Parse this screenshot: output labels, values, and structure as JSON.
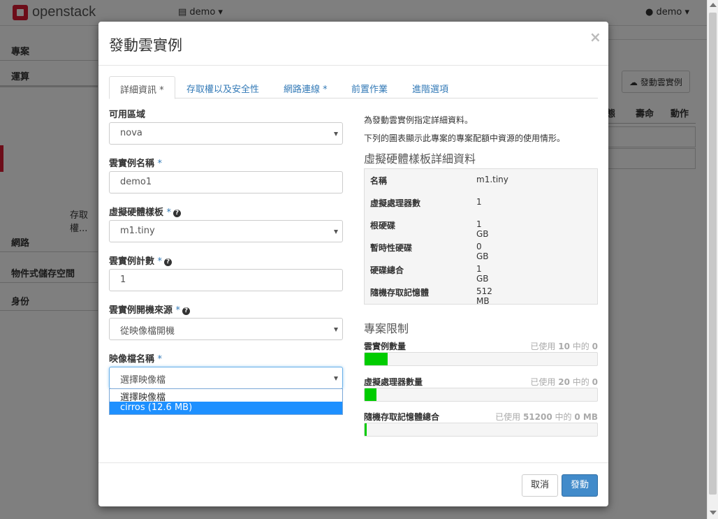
{
  "app": {
    "logo_text": "openstack",
    "project_menu": "demo",
    "user_menu": "demo"
  },
  "sidebar": {
    "items": [
      {
        "label": "專案"
      },
      {
        "label": "運算"
      },
      {
        "label": "存取權..."
      },
      {
        "label": "網路"
      },
      {
        "label": "物件式儲存空間"
      },
      {
        "label": "身份"
      }
    ]
  },
  "background": {
    "launch_button": "發動雲實例",
    "columns": [
      "態",
      "壽命",
      "動作"
    ]
  },
  "modal": {
    "title": "發動雲實例",
    "close": "×",
    "tabs": [
      {
        "label": "詳細資訊",
        "required": "*"
      },
      {
        "label": "存取權以及安全性",
        "required": ""
      },
      {
        "label": "網路連線",
        "required": "*"
      },
      {
        "label": "前置作業",
        "required": ""
      },
      {
        "label": "進階選項",
        "required": ""
      }
    ],
    "form": {
      "availability_zone": {
        "label": "可用區域",
        "value": "nova"
      },
      "instance_name": {
        "label": "雲實例名稱",
        "required": "*",
        "value": "demo1"
      },
      "flavor": {
        "label": "虛擬硬體樣板",
        "required": "*",
        "value": "m1.tiny"
      },
      "instance_count": {
        "label": "雲實例計數",
        "required": "*",
        "value": "1"
      },
      "boot_source": {
        "label": "雲實例開機來源",
        "required": "*",
        "value": "從映像檔開機"
      },
      "image_name": {
        "label": "映像檔名稱",
        "required": "*",
        "value": "選擇映像檔",
        "options": [
          "選擇映像檔",
          "cirros (12.6 MB)"
        ]
      }
    },
    "info": {
      "line1": "為發動雲實例指定詳細資料。",
      "line2": "下列的圖表顯示此專案的專案配額中資源的使用情形。",
      "flavor_title": "虛擬硬體樣板詳細資料",
      "flavor_rows": [
        {
          "k": "名稱",
          "v": "m1.tiny"
        },
        {
          "k": "虛擬處理器數",
          "v": "1"
        },
        {
          "k": "根硬碟",
          "v": "1 GB"
        },
        {
          "k": "暫時性硬碟",
          "v": "0 GB"
        },
        {
          "k": "硬碟總合",
          "v": "1 GB"
        },
        {
          "k": "隨機存取記憶體",
          "v": "512 MB"
        }
      ],
      "limits_title": "專案限制",
      "quotas": [
        {
          "label": "雲實例數量",
          "used_prefix": "已使用",
          "used": "10",
          "mid": "中的",
          "total": "0",
          "fill": 0.1
        },
        {
          "label": "虛擬處理器數量",
          "used_prefix": "已使用",
          "used": "20",
          "mid": "中的",
          "total": "0",
          "fill": 0.05
        },
        {
          "label": "隨機存取記憶體總合",
          "used_prefix": "已使用",
          "used": "51200",
          "mid": "中的",
          "total": "0 MB",
          "fill": 0.01
        }
      ]
    },
    "footer": {
      "cancel": "取消",
      "launch": "發動"
    }
  },
  "colors": {
    "accent": "#428bca",
    "brand": "#da1a32",
    "quota_fill": "#00cc00"
  }
}
